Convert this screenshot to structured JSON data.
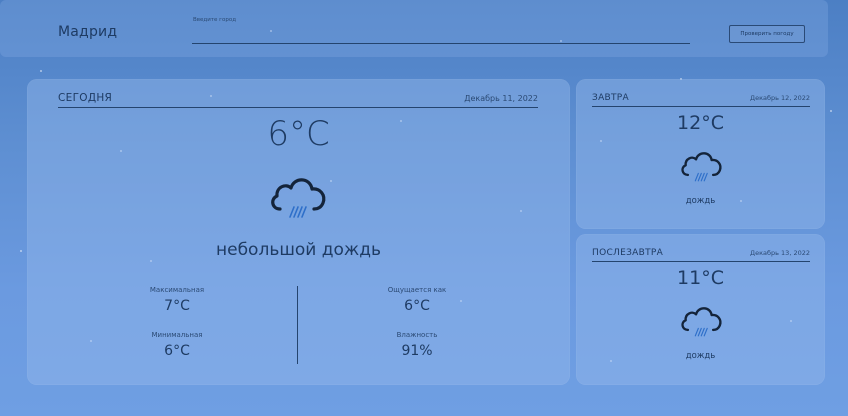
{
  "header": {
    "city": "Мадрид",
    "search_label": "Введите город",
    "search_value": "",
    "search_placeholder": "",
    "check_button": "Проверить погоду"
  },
  "today": {
    "title": "СЕГОДНЯ",
    "date": "Декабрь 11, 2022",
    "temp": "6°C",
    "icon": "rain-cloud-icon",
    "description": "небольшой дождь",
    "max_label": "Максимальная",
    "max_value": "7°C",
    "min_label": "Минимальная",
    "min_value": "6°C",
    "feels_label": "Ощущается как",
    "feels_value": "6°C",
    "humidity_label": "Влажность",
    "humidity_value": "91%"
  },
  "tomorrow": {
    "title": "ЗАВТРА",
    "date": "Декабрь 12, 2022",
    "temp": "12°C",
    "icon": "rain-cloud-icon",
    "description": "дождь"
  },
  "after_tomorrow": {
    "title": "ПОСЛЕЗАВТРА",
    "date": "Декабрь 13, 2022",
    "temp": "11°C",
    "icon": "rain-cloud-icon",
    "description": "дождь"
  },
  "colors": {
    "background": "#5e8fd2",
    "text": "#1e3b63",
    "rain": "#2e6fc9"
  }
}
